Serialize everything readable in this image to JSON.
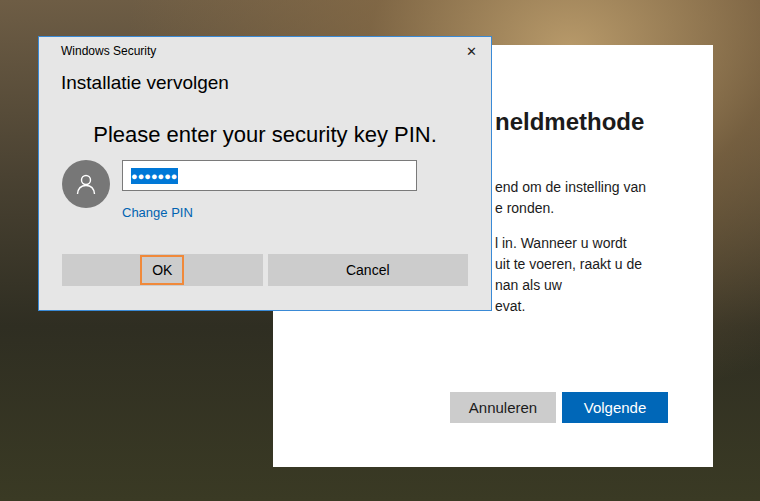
{
  "background_window": {
    "title": "neldmethode",
    "paragraphs": [
      [
        "end om de instelling van",
        "e ronden."
      ],
      [
        "l in. Wanneer u wordt",
        "uit te voeren, raakt u de",
        "nan als uw",
        "evat."
      ]
    ],
    "buttons": [
      {
        "label": "Annuleren",
        "primary": false
      },
      {
        "label": "Volgende",
        "primary": true
      }
    ]
  },
  "dialog": {
    "title": "Windows Security",
    "close": "✕",
    "heading": "Installatie vervolgen",
    "prompt": "Please enter your security key PIN.",
    "pin_field": {
      "value": "●●●●●●●",
      "selected": true
    },
    "link": "Change PIN",
    "buttons": [
      {
        "label": "OK",
        "focused": true
      },
      {
        "label": "Cancel",
        "focused": false
      }
    ]
  }
}
